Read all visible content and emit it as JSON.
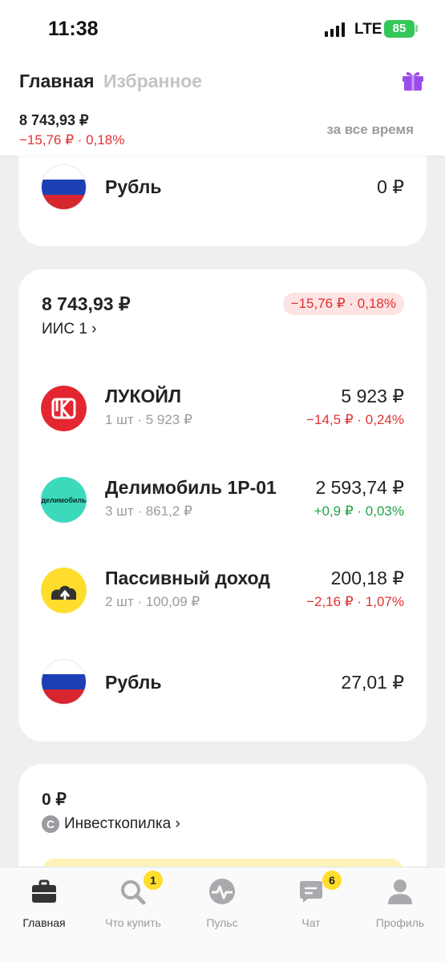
{
  "status_bar": {
    "time": "11:38",
    "network": "LTE",
    "battery": "85"
  },
  "header": {
    "tabs": [
      {
        "label": "Главная",
        "active": true
      },
      {
        "label": "Избранное",
        "active": false
      }
    ],
    "gift_icon": "gift-icon",
    "total": "8 743,93 ₽",
    "change": "−15,76 ₽ · 0,18%",
    "period": "за все время"
  },
  "top_card": {
    "row": {
      "name": "Рубль",
      "value": "0 ₽",
      "icon": "russia-flag-icon"
    }
  },
  "account": {
    "total": "8 743,93 ₽",
    "change": "−15,76 ₽ · 0,18%",
    "name": "ИИС 1 ›",
    "positions": [
      {
        "name": "ЛУКОЙЛ",
        "sub": "1 шт · 5 923 ₽",
        "value": "5 923 ₽",
        "change": "−14,5 ₽ · 0,24%",
        "direction": "neg",
        "icon": "lukoil-logo-icon"
      },
      {
        "name": "Делимобиль 1Р-01",
        "sub": "3 шт · 861,2 ₽",
        "value": "2 593,74 ₽",
        "change": "+0,9 ₽ · 0,03%",
        "direction": "pos",
        "icon": "delimobil-logo-icon",
        "logo_text": "делимобиль"
      },
      {
        "name": "Пассивный доход",
        "sub": "2 шт · 100,09 ₽",
        "value": "200,18 ₽",
        "change": "−2,16 ₽ · 1,07%",
        "direction": "neg",
        "icon": "passive-income-logo-icon"
      },
      {
        "name": "Рубль",
        "sub": "",
        "value": "27,01 ₽",
        "change": "",
        "direction": "",
        "icon": "russia-flag-icon"
      }
    ]
  },
  "piggy": {
    "total": "0 ₽",
    "icon_letter": "С",
    "label": "Инвесткопилка ›"
  },
  "tabbar": {
    "items": [
      {
        "label": "Главная",
        "icon": "briefcase-icon",
        "active": true,
        "badge": ""
      },
      {
        "label": "Что купить",
        "icon": "search-icon",
        "active": false,
        "badge": "1"
      },
      {
        "label": "Пульс",
        "icon": "pulse-icon",
        "active": false,
        "badge": ""
      },
      {
        "label": "Чат",
        "icon": "chat-icon",
        "active": false,
        "badge": "6"
      },
      {
        "label": "Профиль",
        "icon": "profile-icon",
        "active": false,
        "badge": ""
      }
    ]
  },
  "colors": {
    "negative": "#e03131",
    "positive": "#22a447",
    "accent_yellow": "#ffdd2d",
    "gift_purple": "#9b4dea",
    "lukoil_red": "#e3262f",
    "delimobil_teal": "#3dd9bd"
  }
}
